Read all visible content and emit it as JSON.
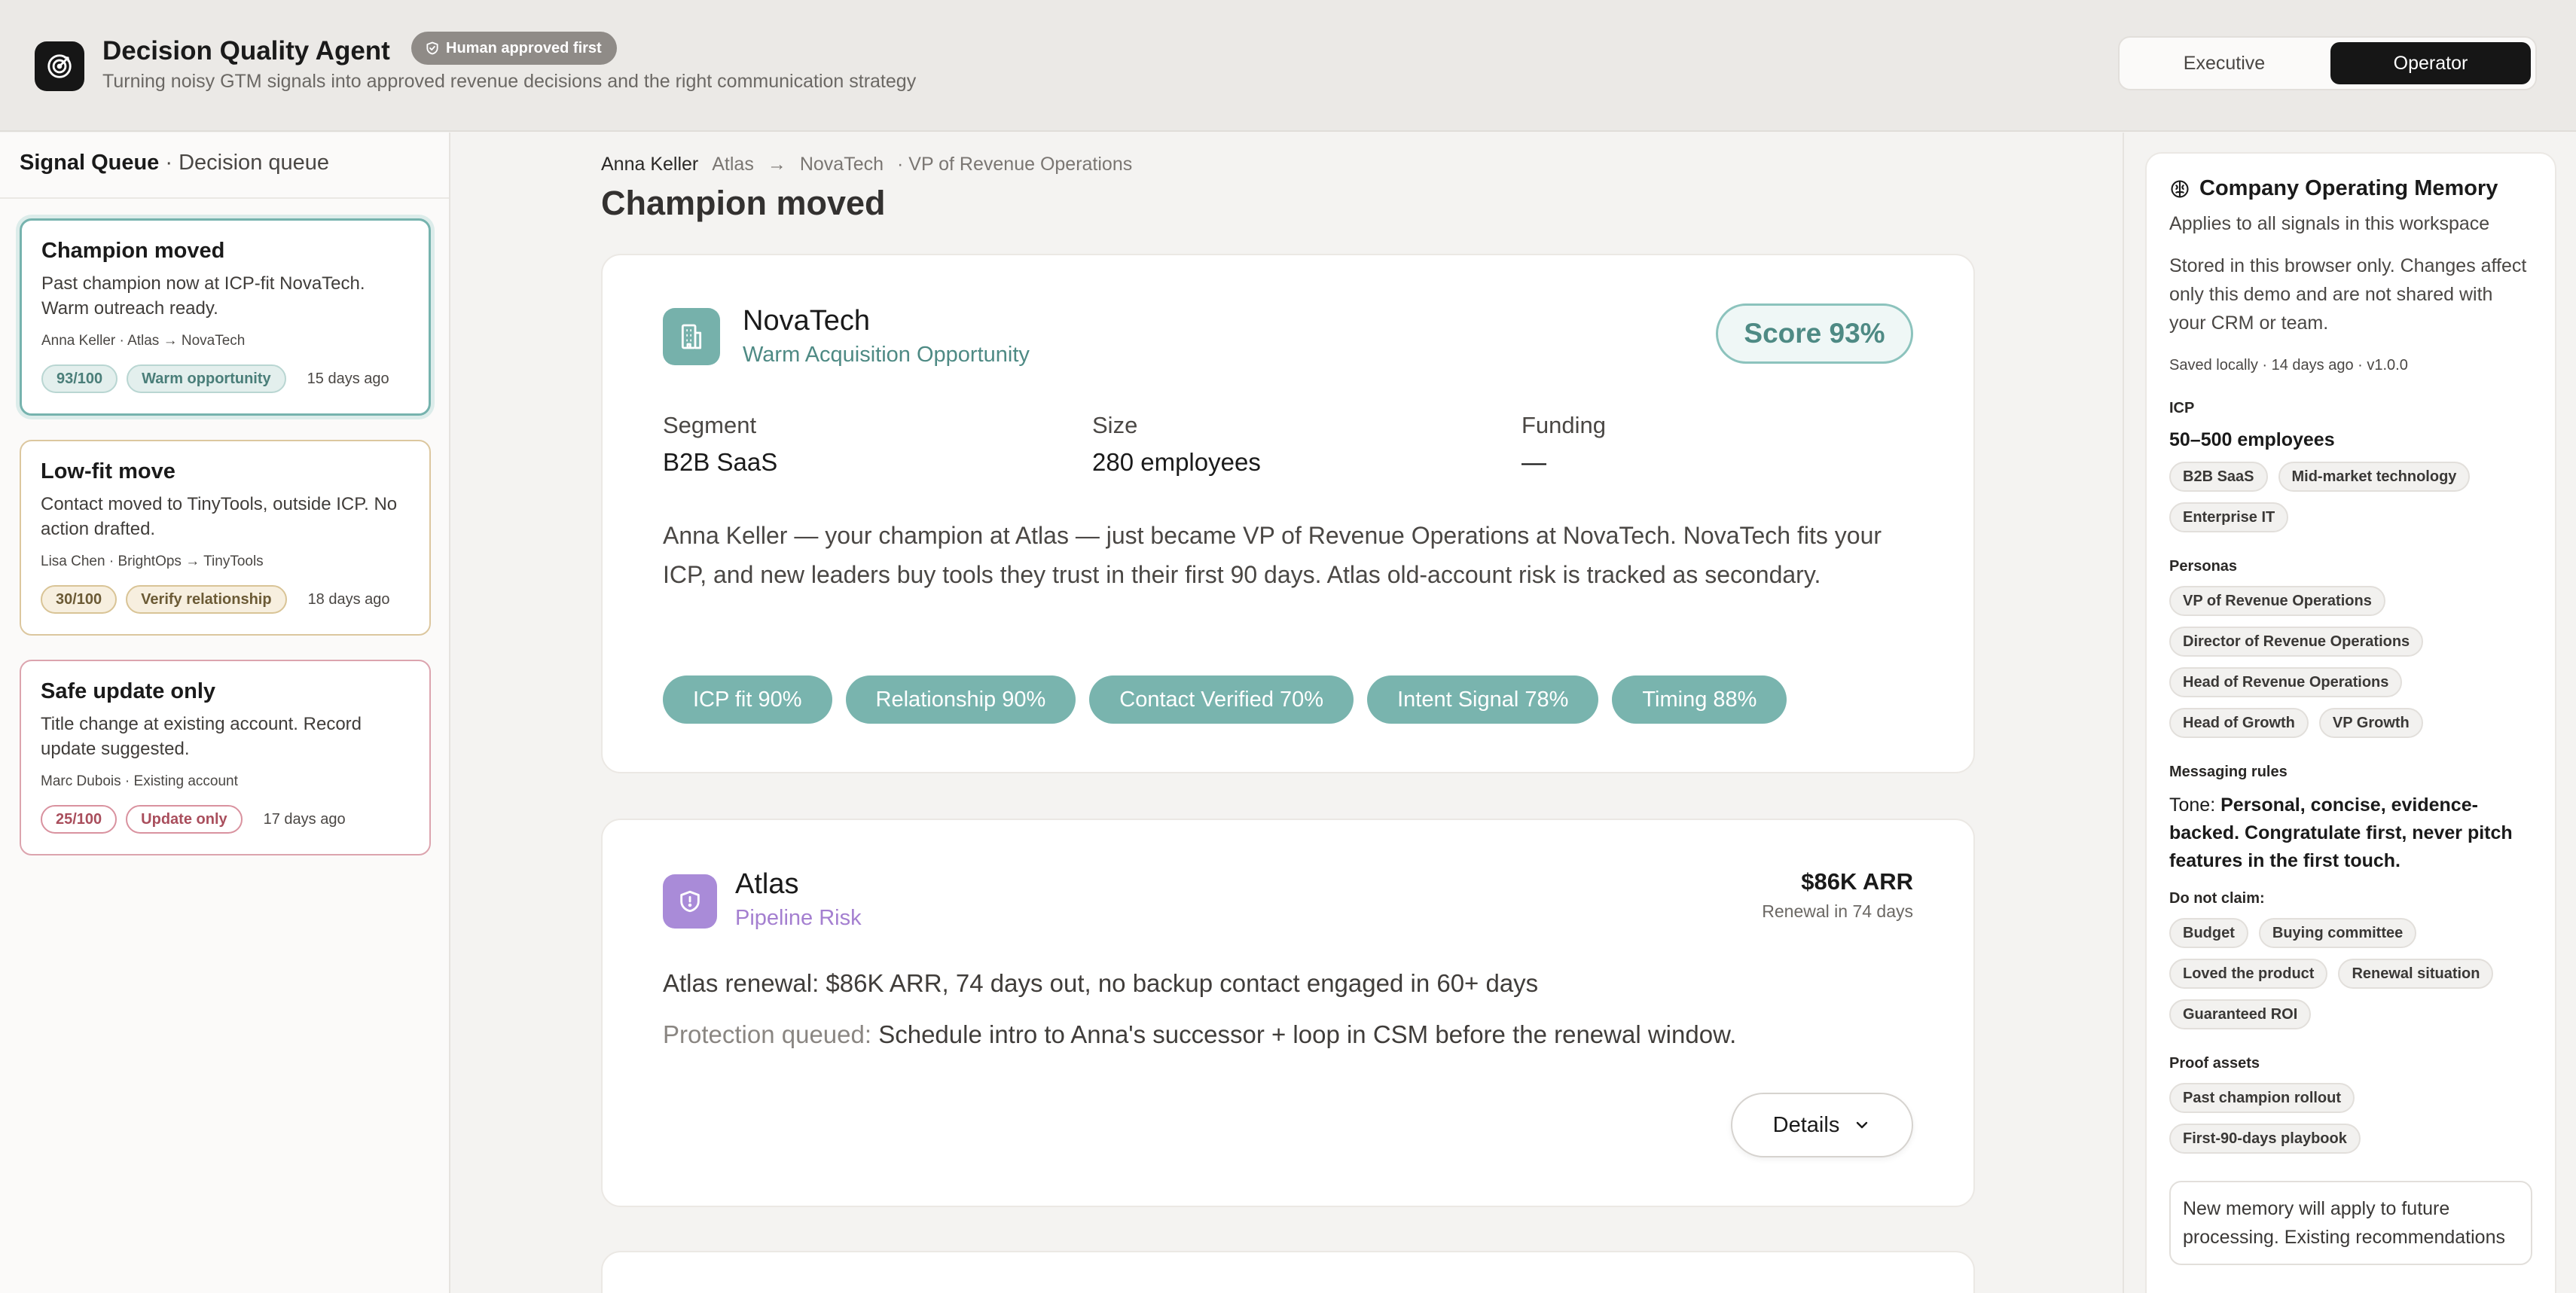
{
  "header": {
    "title": "Decision Quality Agent",
    "badge": "Human approved first",
    "subtitle": "Turning noisy GTM signals into approved revenue decisions and the right communication strategy",
    "views": [
      "Executive",
      "Operator"
    ],
    "active_view": "Operator"
  },
  "sidebar": {
    "title": "Signal Queue",
    "subtitle": "· Decision queue",
    "items": [
      {
        "title": "Champion moved",
        "desc": "Past champion now at ICP-fit NovaTech. Warm outreach ready.",
        "meta": "Anna Keller · Atlas → NovaTech",
        "score": "93/100",
        "tag": "Warm opportunity",
        "ago": "15 days ago"
      },
      {
        "title": "Low-fit move",
        "desc": "Contact moved to TinyTools, outside ICP. No action drafted.",
        "meta": "Lisa Chen · BrightOps → TinyTools",
        "score": "30/100",
        "tag": "Verify relationship",
        "ago": "18 days ago"
      },
      {
        "title": "Safe update only",
        "desc": "Title change at existing account. Record update suggested.",
        "meta": "Marc Dubois · Existing account",
        "score": "25/100",
        "tag": "Update only",
        "ago": "17 days ago"
      }
    ]
  },
  "main": {
    "breadcrumb": {
      "person": "Anna Keller",
      "from": "Atlas",
      "arrow": "→",
      "to": "NovaTech",
      "role": "· VP of Revenue Operations"
    },
    "title": "Champion moved",
    "opportunity": {
      "company": "NovaTech",
      "type": "Warm Acquisition Opportunity",
      "score": "Score 93%",
      "facts": [
        {
          "label": "Segment",
          "value": "B2B SaaS"
        },
        {
          "label": "Size",
          "value": "280 employees"
        },
        {
          "label": "Funding",
          "value": "—"
        }
      ],
      "summary": "Anna Keller — your champion at Atlas — just became VP of Revenue Operations at NovaTech. NovaTech fits your ICP, and new leaders buy tools they trust in their first 90 days. Atlas old-account risk is tracked as secondary.",
      "chips": [
        "ICP fit 90%",
        "Relationship 90%",
        "Contact Verified 70%",
        "Intent Signal 78%",
        "Timing 88%"
      ]
    },
    "risk": {
      "company": "Atlas",
      "type": "Pipeline Risk",
      "arr": "$86K ARR",
      "renewal": "Renewal in 74 days",
      "line1": "Atlas renewal: $86K ARR, 74 days out, no backup contact engaged in 60+ days",
      "line2_label": "Protection queued:",
      "line2": " Schedule intro to Anna's successor + loop in CSM before the renewal window.",
      "details_label": "Details"
    }
  },
  "memory": {
    "title": "Company Operating Memory",
    "subtitle": "Applies to all signals in this workspace",
    "note": "Stored in this browser only. Changes affect only this demo and are not shared with your CRM or team.",
    "saved": "Saved locally · 14 days ago · v1.0.0",
    "icp_label": "ICP",
    "icp_size": "50–500 employees",
    "icp_tags": [
      "B2B SaaS",
      "Mid-market technology",
      "Enterprise IT"
    ],
    "personas_label": "Personas",
    "personas": [
      "VP of Revenue Operations",
      "Director of Revenue Operations",
      "Head of Revenue Operations",
      "Head of Growth",
      "VP Growth"
    ],
    "messaging_label": "Messaging rules",
    "tone_label": "Tone: ",
    "tone": "Personal, concise, evidence-backed. Congratulate first, never pitch features in the first touch.",
    "dont_claim_label": "Do not claim:",
    "dont_claim": [
      "Budget",
      "Buying committee",
      "Loved the product",
      "Renewal situation",
      "Guaranteed ROI"
    ],
    "proof_label": "Proof assets",
    "proof": [
      "Past champion rollout",
      "First-90-days playbook"
    ],
    "new_memory": "New memory will apply to future processing. Existing recommendations"
  }
}
